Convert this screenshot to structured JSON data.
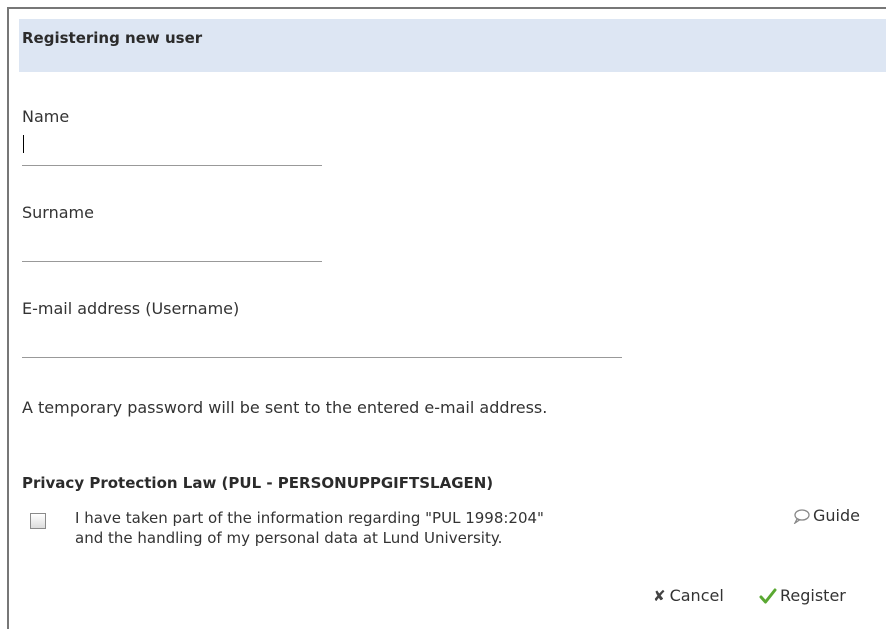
{
  "form": {
    "title": "Registering new user",
    "name_label": "Name",
    "name_value": "",
    "surname_label": "Surname",
    "surname_value": "",
    "email_label": "E-mail address (Username)",
    "email_value": "",
    "info_text": "A temporary password will be sent to the entered e-mail address."
  },
  "privacy": {
    "heading": "Privacy Protection Law (PUL - PERSONUPPGIFTSLAGEN)",
    "consent_line1": "I have taken part of the information regarding \"PUL 1998:204\"",
    "consent_line2": "and the handling of my personal data at Lund University.",
    "checked": false,
    "guide_label": "Guide",
    "guide_icon": "speech-bubble-icon"
  },
  "actions": {
    "cancel_label": "Cancel",
    "cancel_icon": "x-icon",
    "register_label": "Register",
    "register_icon": "checkmark-icon",
    "register_icon_color": "#5aa832"
  },
  "colors": {
    "header_background": "#dde6f3"
  }
}
